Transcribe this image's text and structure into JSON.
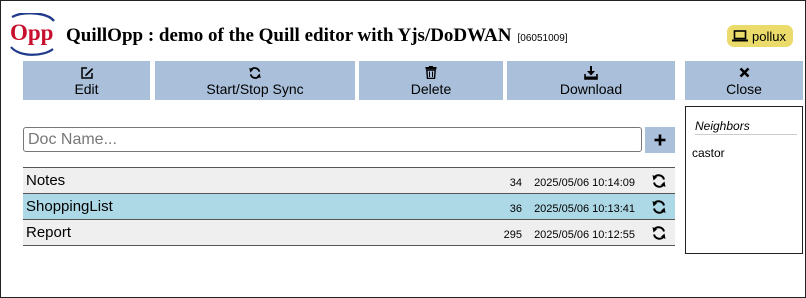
{
  "header": {
    "logo_text": "Opp",
    "title": "QuillOpp : demo of the Quill editor with Yjs/DoDWAN",
    "version": "[06051009]",
    "user": "pollux"
  },
  "toolbar": {
    "edit_label": "Edit",
    "sync_label": "Start/Stop Sync",
    "delete_label": "Delete",
    "download_label": "Download",
    "close_label": "Close"
  },
  "new_doc": {
    "placeholder": "Doc Name...",
    "value": "",
    "add_label": "+"
  },
  "documents": [
    {
      "name": "Notes",
      "size": "34",
      "date": "2025/05/06 10:14:09",
      "selected": false
    },
    {
      "name": "ShoppingList",
      "size": "36",
      "date": "2025/05/06 10:13:41",
      "selected": true
    },
    {
      "name": "Report",
      "size": "295",
      "date": "2025/05/06 10:12:55",
      "selected": false
    }
  ],
  "neighbors": {
    "title": "Neighbors",
    "items": [
      "castor"
    ]
  },
  "colors": {
    "toolbar_button": "#a9bfda",
    "selected_row": "#add8e6",
    "row": "#efefef",
    "user_badge": "#eadb6b",
    "logo_red": "#c8102e",
    "logo_blue": "#1f3a8a"
  },
  "icons": {
    "edit": "edit-icon",
    "sync": "sync-icon",
    "delete": "trash-icon",
    "download": "download-icon",
    "close": "close-icon",
    "user": "laptop-icon",
    "add": "plus-icon",
    "row_sync": "sync-icon"
  }
}
